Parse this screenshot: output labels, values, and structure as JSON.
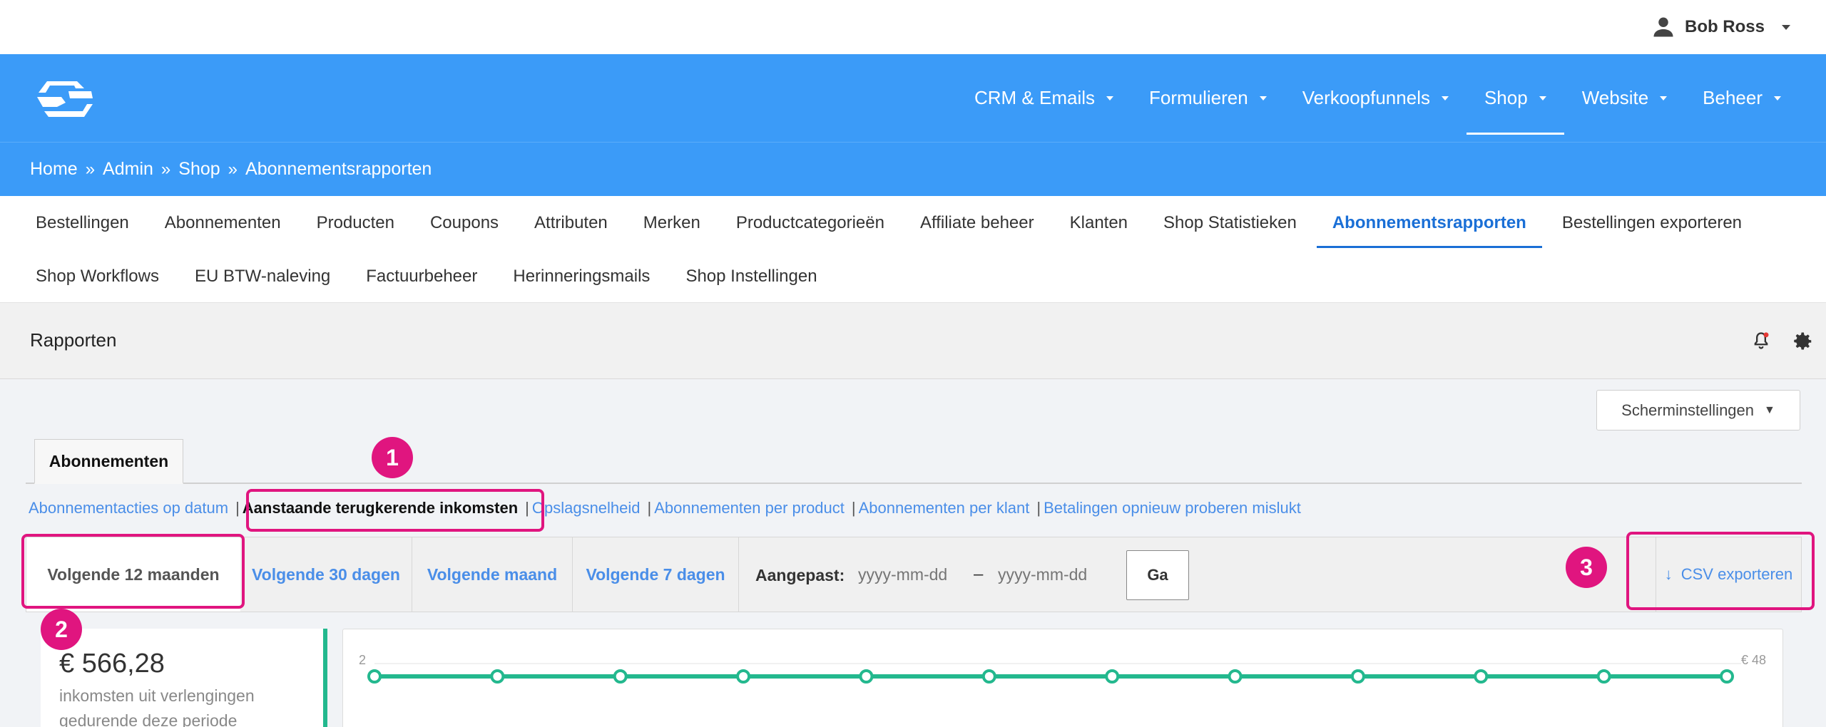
{
  "user": {
    "name": "Bob Ross"
  },
  "mainnav": {
    "items": [
      {
        "label": "CRM & Emails"
      },
      {
        "label": "Formulieren"
      },
      {
        "label": "Verkoopfunnels"
      },
      {
        "label": "Shop",
        "active": true
      },
      {
        "label": "Website"
      },
      {
        "label": "Beheer"
      }
    ]
  },
  "breadcrumb": [
    "Home",
    "Admin",
    "Shop",
    "Abonnementsrapporten"
  ],
  "breadcrumb_sep": "»",
  "subnav": {
    "row1": [
      "Bestellingen",
      "Abonnementen",
      "Producten",
      "Coupons",
      "Attributen",
      "Merken",
      "Productcategorieën",
      "Affiliate beheer",
      "Klanten",
      "Shop Statistieken",
      "Abonnementsrapporten",
      "Bestellingen exporteren"
    ],
    "row2": [
      "Shop Workflows",
      "EU BTW-naleving",
      "Factuurbeheer",
      "Herinneringsmails",
      "Shop Instellingen"
    ],
    "active": "Abonnementsrapporten"
  },
  "page": {
    "title": "Rapporten"
  },
  "screen_settings": {
    "label": "Scherminstellingen",
    "caret": "▼"
  },
  "tabs": {
    "active": "Abonnementen"
  },
  "report_links": {
    "sep": "|",
    "items": [
      "Abonnementacties op datum",
      "Aanstaande terugkerende inkomsten",
      "Opslagsnelheid",
      "Abonnementen per product",
      "Abonnementen per klant",
      "Betalingen opnieuw proberen mislukt"
    ],
    "current": "Aanstaande terugkerende inkomsten"
  },
  "periods": {
    "items": [
      "Volgende 12 maanden",
      "Volgende 30 dagen",
      "Volgende maand",
      "Volgende 7 dagen"
    ],
    "selected": "Volgende 12 maanden",
    "custom_label": "Aangepast:",
    "from_placeholder": "yyyy-mm-dd",
    "to_placeholder": "yyyy-mm-dd",
    "dash": "–",
    "go_label": "Ga"
  },
  "export": {
    "label": "CSV exporteren",
    "arrow": "↓"
  },
  "summary": {
    "amount": "€ 566,28",
    "description": "inkomsten uit verlengingen gedurende deze periode"
  },
  "chart_data": {
    "type": "line",
    "left_axis_label": "2",
    "right_axis_label": "€ 48",
    "points": 12,
    "values": [
      2,
      2,
      2,
      2,
      2,
      2,
      2,
      2,
      2,
      2,
      2,
      2
    ],
    "color": "#23b88e"
  },
  "annotations": [
    "1",
    "2",
    "3"
  ],
  "colors": {
    "accent": "#3b9bf8",
    "link": "#4a8ee8",
    "highlight": "#e0157f",
    "chart": "#23b88e"
  }
}
